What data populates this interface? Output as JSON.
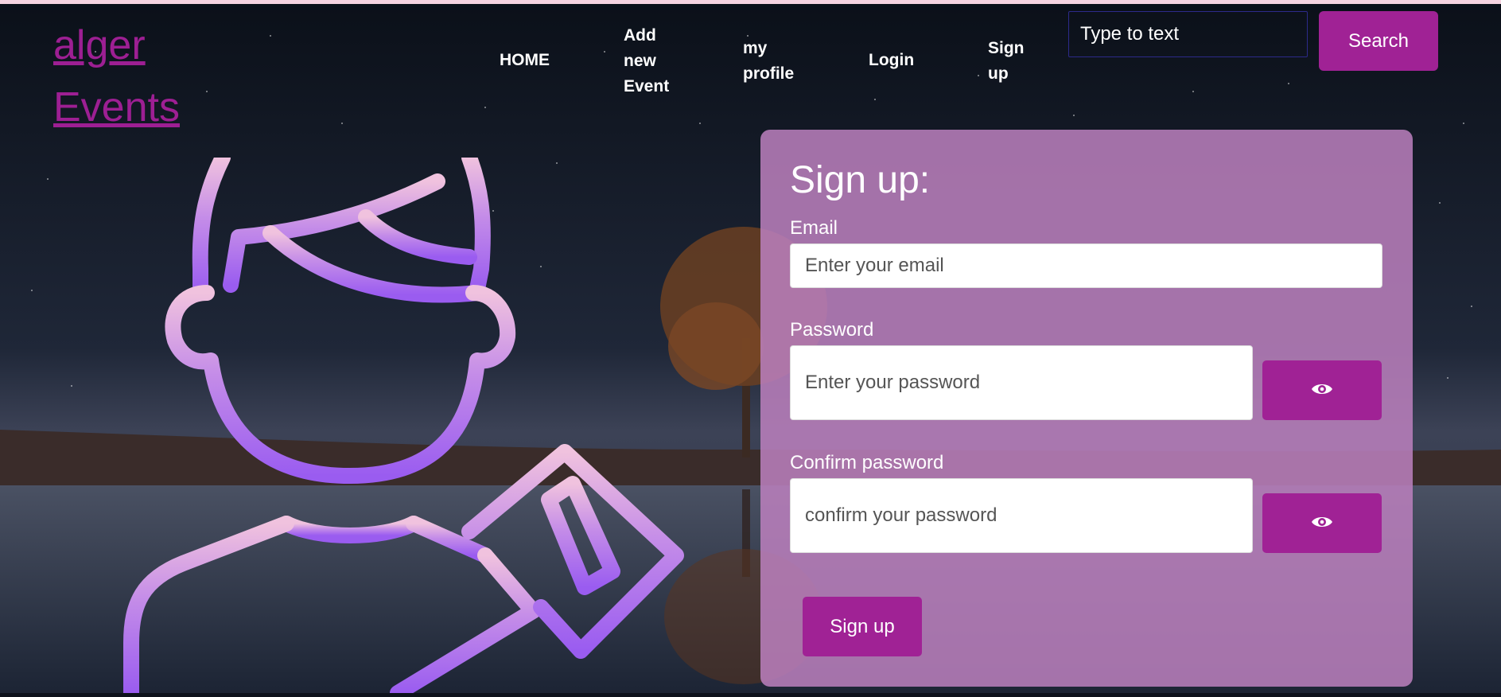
{
  "app": {
    "logo_line1": "alger",
    "logo_line2": "Events"
  },
  "nav": {
    "home": "HOME",
    "add_event": "Add\nnew\nEvent",
    "my_profile": "my\nprofile",
    "login": "Login",
    "sign_up": "Sign\nup"
  },
  "search": {
    "placeholder": "Type to text",
    "button_label": "Search"
  },
  "form": {
    "title": "Sign up:",
    "email_label": "Email",
    "email_placeholder": "Enter your email",
    "password_label": "Password",
    "password_placeholder": "Enter your password",
    "confirm_label": "Confirm password",
    "confirm_placeholder": "confirm your password",
    "submit_label": "Sign up"
  },
  "icons": {
    "toggle_visibility": "eye-icon",
    "illustration": "user-edit-icon"
  },
  "colors": {
    "accent": "#a02295",
    "logo_link": "#9d1f93",
    "card_background": "#bc80be",
    "avatar_gradient_top": "#f0c2de",
    "avatar_gradient_bottom": "#9a5cf0"
  }
}
